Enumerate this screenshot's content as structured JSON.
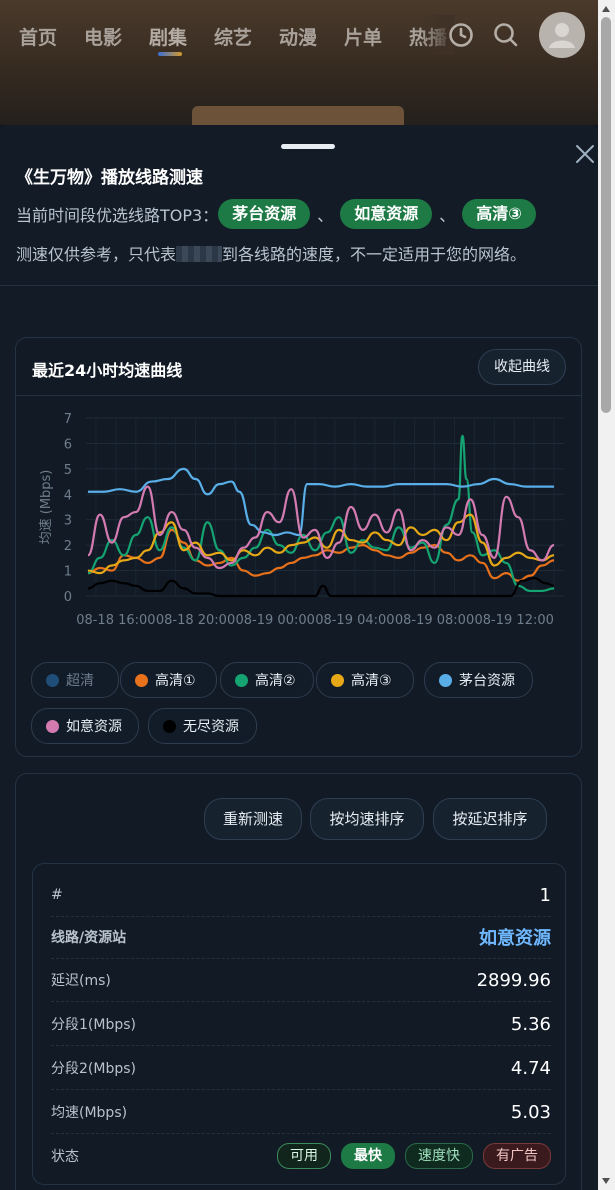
{
  "nav": {
    "items": [
      "首页",
      "电影",
      "剧集",
      "综艺",
      "动漫",
      "片单",
      "热播"
    ],
    "active_index": 2
  },
  "sheet": {
    "title": "《生万物》播放线路测速",
    "top3_prefix": "当前时间段优选线路TOP3：",
    "top3": [
      "茅台资源",
      "如意资源",
      "高清③"
    ],
    "separator": "、",
    "notice_before": "测速仅供参考，只代表",
    "notice_after": "到各线路的速度，不一定适用于您的网络。"
  },
  "chart_card": {
    "title": "最近24小时均速曲线",
    "collapse_label": "收起曲线"
  },
  "chart_data": {
    "type": "line",
    "ylabel": "均速 (Mbps)",
    "ylim": [
      0,
      7
    ],
    "yticks": [
      "0",
      "1",
      "2",
      "3",
      "4",
      "5",
      "6",
      "7"
    ],
    "xlim": [
      14.5,
      38.5
    ],
    "xticks": [
      {
        "x": 16,
        "label": "08-18 16:00"
      },
      {
        "x": 20,
        "label": "08-18 20:00"
      },
      {
        "x": 24,
        "label": "08-19 00:00"
      },
      {
        "x": 28,
        "label": "08-19 04:00"
      },
      {
        "x": 32,
        "label": "08-19 08:00"
      },
      {
        "x": 36,
        "label": "08-19 12:00"
      }
    ],
    "x_unit": "hours since 08-18 00:00",
    "grid": true,
    "series": [
      {
        "name": "超清",
        "color": "#1f4e79",
        "visible": false,
        "values": []
      },
      {
        "name": "高清①",
        "color": "#e8711b",
        "x": [
          14.6,
          15.2,
          15.8,
          16.4,
          17,
          17.6,
          18.2,
          18.8,
          19.4,
          20,
          20.6,
          21.2,
          21.8,
          22.4,
          23,
          23.6,
          24.2,
          24.8,
          25.4,
          26,
          26.6,
          27.2,
          27.8,
          28.4,
          29,
          29.6,
          30.2,
          30.8,
          31.4,
          32,
          32.6,
          33.2,
          33.8,
          34.4,
          35,
          35.6,
          36.2,
          36.8,
          37.4,
          38
        ],
        "values": [
          0.9,
          1.1,
          1.0,
          1.6,
          1.5,
          1.3,
          1.5,
          2.6,
          2.1,
          1.4,
          1.2,
          1.3,
          1.5,
          1.0,
          0.8,
          0.9,
          1.1,
          1.3,
          1.5,
          1.6,
          1.8,
          1.7,
          1.9,
          2.0,
          1.8,
          1.6,
          1.5,
          1.7,
          1.9,
          2.0,
          1.7,
          1.4,
          1.6,
          1.3,
          0.7,
          0.9,
          0.6,
          0.8,
          1.2,
          1.4
        ]
      },
      {
        "name": "高清②",
        "color": "#15a372",
        "x": [
          14.6,
          15.2,
          15.8,
          16.4,
          17,
          17.6,
          18.2,
          18.8,
          19.4,
          20,
          20.6,
          21.2,
          21.8,
          22.4,
          23,
          23.6,
          24.2,
          24.8,
          25.4,
          26,
          26.6,
          27.2,
          27.8,
          28.4,
          29,
          29.6,
          30.2,
          30.8,
          31.4,
          32,
          32.6,
          33.2,
          33.4,
          33.6,
          33.9,
          34.4,
          35,
          35.6,
          36.2,
          36.8,
          37.4,
          38
        ],
        "values": [
          0.9,
          1.5,
          2.2,
          1.6,
          2.4,
          3.1,
          1.8,
          2.7,
          1.9,
          1.4,
          2.9,
          1.8,
          1.2,
          1.5,
          1.9,
          2.6,
          2.0,
          1.7,
          2.4,
          1.8,
          2.5,
          3.1,
          1.7,
          2.2,
          1.9,
          1.8,
          2.7,
          1.9,
          2.1,
          1.3,
          2.8,
          3.8,
          6.3,
          4.6,
          2.5,
          1.6,
          1.8,
          1.3,
          0.4,
          0.2,
          0.2,
          0.3
        ]
      },
      {
        "name": "高清③",
        "color": "#e6a817",
        "x": [
          14.6,
          15.2,
          15.8,
          16.4,
          17,
          17.6,
          18.2,
          18.8,
          19.4,
          20,
          20.6,
          21.2,
          21.8,
          22.4,
          23,
          23.6,
          24.2,
          24.8,
          25.4,
          26,
          26.6,
          27.2,
          27.8,
          28.4,
          29,
          29.6,
          30.2,
          30.8,
          31.4,
          32,
          32.6,
          33.2,
          33.8,
          34.4,
          35,
          35.6,
          36.2,
          36.8,
          37.4,
          38
        ],
        "values": [
          1.0,
          0.9,
          1.2,
          1.4,
          1.5,
          1.8,
          2.5,
          2.9,
          1.8,
          2.1,
          1.6,
          1.7,
          1.4,
          1.8,
          1.6,
          1.9,
          1.7,
          2.0,
          2.1,
          2.3,
          1.9,
          2.6,
          2.2,
          2.1,
          2.5,
          2.2,
          2.0,
          2.7,
          2.4,
          2.6,
          2.2,
          2.9,
          3.2,
          2.1,
          1.2,
          1.5,
          1.7,
          1.5,
          1.4,
          1.6
        ]
      },
      {
        "name": "茅台资源",
        "color": "#5aaee8",
        "x": [
          14.6,
          15.4,
          16.2,
          17,
          17.8,
          18.6,
          19.4,
          20,
          20.6,
          21.2,
          21.8,
          22.2,
          22.8,
          23.4,
          24,
          24.6,
          25.2,
          25.6,
          26.2,
          27,
          27.8,
          28.6,
          29.4,
          30.2,
          31,
          31.8,
          32.6,
          33.4,
          34.2,
          35,
          35.8,
          36.6,
          37.4,
          38
        ],
        "values": [
          4.1,
          4.1,
          4.2,
          4.1,
          4.5,
          4.6,
          5.0,
          4.6,
          4.0,
          4.4,
          4.5,
          4.1,
          2.8,
          2.5,
          2.4,
          2.5,
          2.4,
          4.4,
          4.4,
          4.3,
          4.4,
          4.3,
          4.3,
          4.4,
          4.4,
          4.4,
          4.4,
          4.3,
          4.4,
          4.6,
          4.4,
          4.3,
          4.3,
          4.3
        ]
      },
      {
        "name": "如意资源",
        "color": "#d37bb1",
        "x": [
          14.6,
          15.2,
          15.8,
          16.4,
          17,
          17.6,
          18.2,
          18.8,
          19.4,
          20,
          20.6,
          21.2,
          21.8,
          22.4,
          23,
          23.6,
          24.2,
          24.8,
          25.4,
          26,
          26.6,
          27.2,
          27.8,
          28.4,
          29,
          29.6,
          30.2,
          30.8,
          31.4,
          32,
          32.6,
          33.2,
          33.8,
          34.4,
          35,
          35.6,
          36.2,
          36.8,
          37.4,
          38
        ],
        "values": [
          1.6,
          3.2,
          2.1,
          3.1,
          3.3,
          4.3,
          2.4,
          3.3,
          2.6,
          1.9,
          1.5,
          1.1,
          1.3,
          1.9,
          2.3,
          3.3,
          2.9,
          4.2,
          2.3,
          2.6,
          1.5,
          2.1,
          3.5,
          2.6,
          3.2,
          2.5,
          3.4,
          1.8,
          2.2,
          1.9,
          2.7,
          2.4,
          3.8,
          2.4,
          1.5,
          3.9,
          3.1,
          1.8,
          1.4,
          2.0
        ]
      },
      {
        "name": "无尽资源",
        "color": "#000000",
        "x": [
          14.6,
          15.2,
          15.8,
          16.4,
          17,
          17.6,
          18.2,
          18.8,
          19.4,
          20,
          20.6,
          21.2,
          21.8,
          22.4,
          23,
          23.6,
          24.2,
          24.8,
          25.4,
          26,
          26.4,
          26.8,
          27.4,
          28,
          28.6,
          29.2,
          29.8,
          30.4,
          31,
          31.6,
          32.2,
          32.8,
          33.4,
          34,
          34.6,
          35.2,
          35.8,
          36.4,
          37,
          37.6,
          38
        ],
        "values": [
          0.3,
          0.5,
          0.6,
          0.5,
          0.4,
          0.2,
          0.2,
          0.6,
          0.3,
          0.1,
          0.1,
          0.0,
          0.0,
          0.0,
          0.0,
          0.0,
          0.0,
          0.0,
          0.0,
          0.0,
          0.4,
          0.0,
          0.0,
          0.0,
          0.0,
          0.0,
          0.0,
          0.0,
          0.0,
          0.0,
          0.0,
          0.0,
          0.0,
          0.0,
          0.0,
          0.0,
          0.0,
          0.6,
          0.7,
          0.5,
          0.4
        ]
      }
    ]
  },
  "legend": [
    {
      "label": "超清",
      "color": "#1f4e79",
      "on": false
    },
    {
      "label": "高清①",
      "color": "#e8711b",
      "on": true
    },
    {
      "label": "高清②",
      "color": "#15a372",
      "on": true
    },
    {
      "label": "高清③",
      "color": "#e6a817",
      "on": true
    },
    {
      "label": "茅台资源",
      "color": "#5aaee8",
      "on": true
    },
    {
      "label": "如意资源",
      "color": "#d37bb1",
      "on": true
    },
    {
      "label": "无尽资源",
      "color": "#000000",
      "on": true
    }
  ],
  "results": {
    "retest_label": "重新测速",
    "sort_speed_label": "按均速排序",
    "sort_latency_label": "按延迟排序",
    "row": {
      "rank_label": "#",
      "rank": "1",
      "line_label": "线路/资源站",
      "line": "如意资源",
      "latency_label": "延迟(ms)",
      "latency": "2899.96",
      "seg1_label": "分段1(Mbps)",
      "seg1": "5.36",
      "seg2_label": "分段2(Mbps)",
      "seg2": "4.74",
      "avg_label": "均速(Mbps)",
      "avg": "5.03",
      "status_label": "状态",
      "tags": [
        "可用",
        "最快",
        "速度快",
        "有广告"
      ]
    }
  }
}
